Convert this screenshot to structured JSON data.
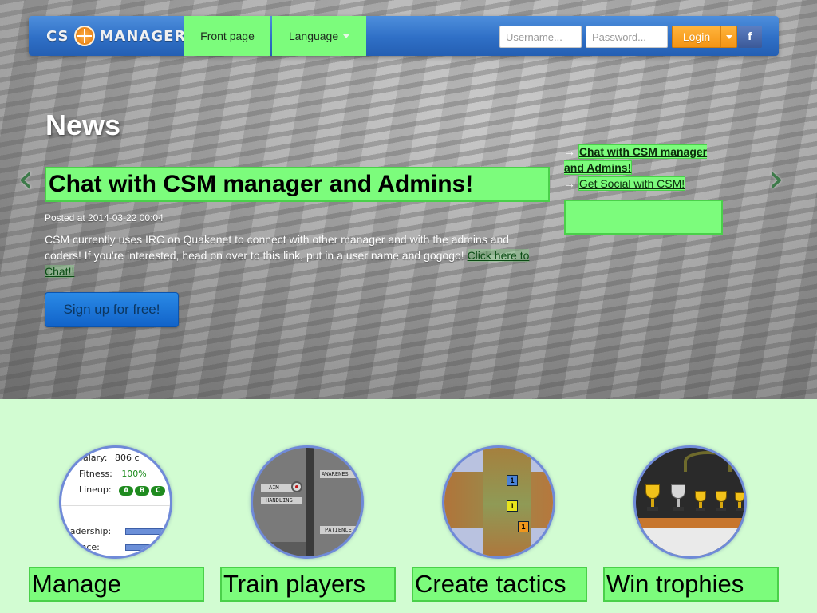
{
  "header": {
    "logo_left": "CS",
    "logo_right": "MANAGER",
    "nav": {
      "front_page": "Front page",
      "language": "Language"
    },
    "username_placeholder": "Username...",
    "password_placeholder": "Password...",
    "login_label": "Login",
    "facebook_label": "f"
  },
  "news": {
    "heading": "News",
    "prev_arrow": "‹",
    "next_arrow": "›",
    "article": {
      "title": "Chat with CSM manager and Admins!",
      "posted": "Posted at 2014-03-22 00:04",
      "body": "CSM currently uses IRC on Quakenet to connect with other manager and with the admins and coders! If you're interested, head on over to this link, put in a user name and gogogo!",
      "link_text": "Click here to Chat!!"
    },
    "signup_label": "Sign up for free!",
    "side_links": [
      {
        "arrow": "→",
        "text": "Chat with CSM manager and Admins!"
      },
      {
        "arrow": "→",
        "text": "Get Social with CSM!"
      }
    ]
  },
  "features": {
    "manage": {
      "label": "Manage",
      "salary_label": "Salary:",
      "salary_value": "806 c",
      "fitness_label": "Fitness:",
      "fitness_value": "100%",
      "lineup_label": "Lineup:",
      "lineup_pills": [
        "A",
        "B",
        "C"
      ],
      "leadership_label": "eadership:",
      "experience_label": "rience:"
    },
    "train": {
      "label": "Train players",
      "awareness": "AWARENES",
      "aim": "AIM",
      "handling": "HANDLING",
      "patience": "PATIENCE"
    },
    "tactics": {
      "label": "Create tactics",
      "markers": [
        "1",
        "1",
        "1"
      ]
    },
    "trophies": {
      "label": "Win trophies"
    }
  },
  "colors": {
    "accent_green": "#7cfc7c",
    "topbar_blue": "#2f6fc6",
    "login_orange": "#f49414",
    "page_background": "#d2fcd2"
  }
}
